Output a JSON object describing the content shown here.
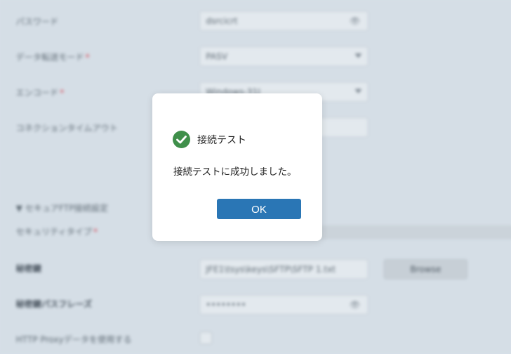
{
  "background_form": {
    "rows": [
      {
        "label": "パスワード",
        "value": "dsrcicrt"
      },
      {
        "label": "データ転送モード",
        "required": "*",
        "value": "PASV"
      },
      {
        "label": "エンコード",
        "required": "*",
        "value": "Windows-31J"
      },
      {
        "label": "コネクションタイムアウト",
        "value": ""
      }
    ],
    "secure_section": {
      "toggle": "▼ セキュアFTP接続設定",
      "security_type_label": "セキュリティタイプ",
      "security_type_required": "*",
      "key_label": "秘密鍵",
      "key_value": "JFE1\\tsys\\keys\\SFTP\\SFTP 1.txt",
      "browse_label": "Browse",
      "passphrase_label": "秘密鍵パスフレーズ",
      "passphrase_value": "••••••••",
      "proxy_label": "HTTP Proxyデータを使用する"
    }
  },
  "dialog": {
    "title": "接続テスト",
    "message": "接続テストに成功しました。",
    "ok_label": "OK",
    "icon": "check-circle-icon",
    "icon_color": "#3f8f4a",
    "button_color": "#2a76b5"
  }
}
